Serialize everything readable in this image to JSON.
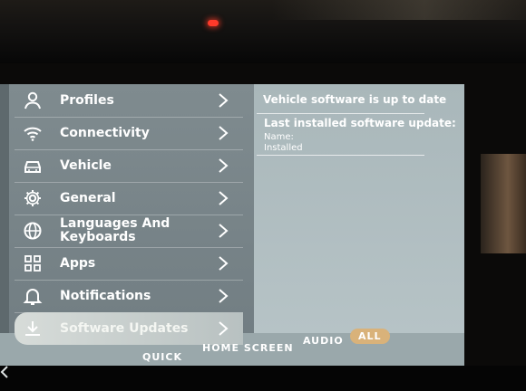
{
  "menu": {
    "items": [
      {
        "label": "Profiles",
        "icon": "person-icon"
      },
      {
        "label": "Connectivity",
        "icon": "wifi-icon"
      },
      {
        "label": "Vehicle",
        "icon": "car-icon"
      },
      {
        "label": "General",
        "icon": "gear-icon"
      },
      {
        "label": "Languages And\nKeyboards",
        "icon": "globe-icon"
      },
      {
        "label": "Apps",
        "icon": "apps-grid-icon"
      },
      {
        "label": "Notifications",
        "icon": "bell-icon"
      },
      {
        "label": "Software Updates",
        "icon": "download-icon"
      }
    ],
    "selected": "Software Updates"
  },
  "detail": {
    "status": "Vehicle software is up to date",
    "last_title": "Last installed software update:",
    "name_label": "Name:",
    "installed_label": "Installed"
  },
  "bottom_tabs": {
    "quick": "QUICK",
    "home_screen": "HOME SCREEN",
    "audio": "AUDIO",
    "all": "ALL"
  },
  "colors": {
    "accent_all": "#d9b27a",
    "indicator_red": "#ff3a2a"
  }
}
